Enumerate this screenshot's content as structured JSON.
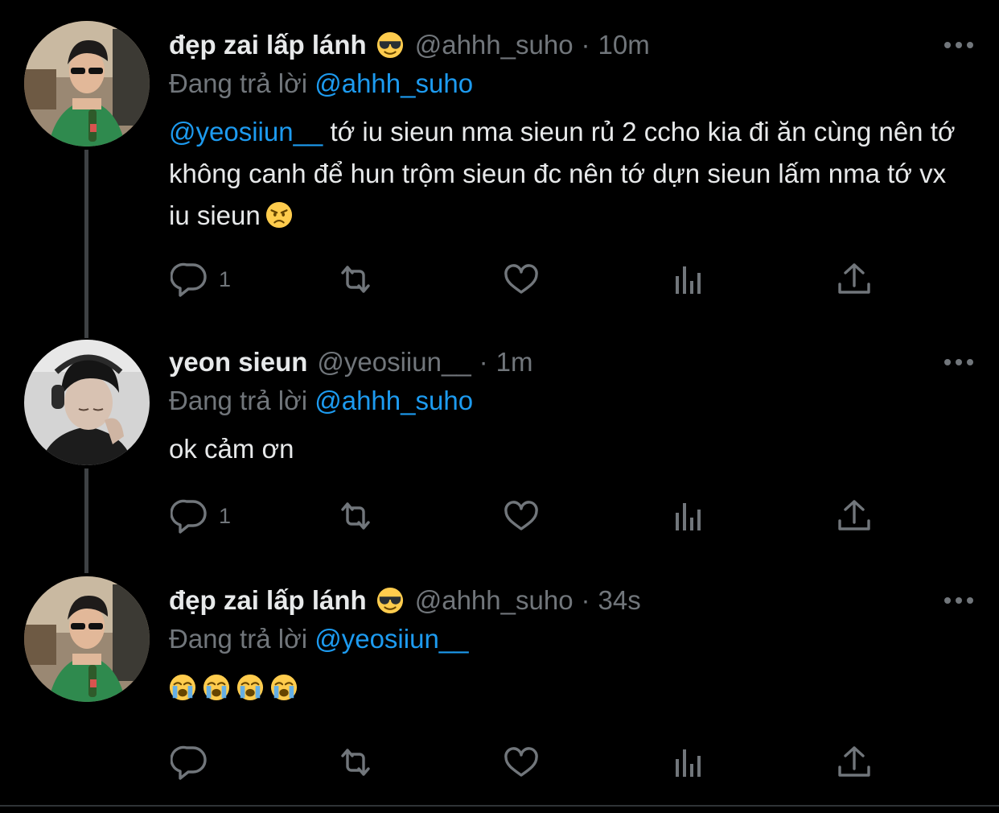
{
  "colors": {
    "background": "#000000",
    "text_primary": "#e7e9ea",
    "text_secondary": "#71767b",
    "accent": "#1d9bf0",
    "thread_line": "#3e4144"
  },
  "icons": {
    "reply": "speech-bubble-icon",
    "retweet": "retweet-arrows-icon",
    "like": "heart-icon",
    "views": "bar-chart-icon",
    "share": "share-upload-icon",
    "more": "three-dots-icon"
  },
  "tweets": [
    {
      "display_name": "đẹp zai lấp lánh",
      "name_emoji": "smiling-face-with-sunglasses",
      "handle": "@ahhh_suho",
      "separator": "·",
      "time": "10m",
      "replying_label": "Đang trả lời",
      "replying_to": "@ahhh_suho",
      "body_mention": "@yeosiiun__",
      "body_text": " tớ iu sieun nma sieun rủ 2 ccho kia đi ăn cùng nên tớ không canh để hun trộm sieun đc nên tớ dựn sieun lấm nma tớ vx iu sieun",
      "body_emoji": "angry-face",
      "reply_count": "1"
    },
    {
      "display_name": "yeon sieun",
      "handle": "@yeosiiun__",
      "separator": "·",
      "time": "1m",
      "replying_label": "Đang trả lời",
      "replying_to": "@ahhh_suho",
      "body_text": "ok cảm ơn",
      "reply_count": "1"
    },
    {
      "display_name": "đẹp zai lấp lánh",
      "name_emoji": "smiling-face-with-sunglasses",
      "handle": "@ahhh_suho",
      "separator": "·",
      "time": "34s",
      "replying_label": "Đang trả lời",
      "replying_to": "@yeosiiun__",
      "body_emojis": [
        "loudly-crying-face",
        "loudly-crying-face",
        "loudly-crying-face",
        "loudly-crying-face"
      ],
      "reply_count": ""
    }
  ]
}
